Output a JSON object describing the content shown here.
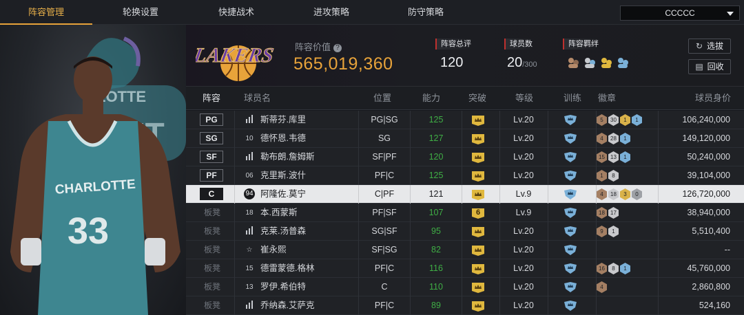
{
  "tabs": [
    "阵容管理",
    "轮换设置",
    "快捷战术",
    "进攻策略",
    "防守策略"
  ],
  "selector": {
    "value": "CCCCC"
  },
  "header": {
    "value_label": "阵容价值",
    "value": "565,019,360",
    "overall_label": "阵容总评",
    "overall": "120",
    "players_label": "球员数",
    "players": "20",
    "players_max": "/300",
    "bond_label": "阵容羁绊",
    "scout_btn": "选拔",
    "recycle_btn": "回收"
  },
  "columns": [
    "阵容",
    "球员名",
    "位置",
    "能力",
    "突破",
    "等级",
    "训练",
    "徽章",
    "球员身价"
  ],
  "colors": {
    "accent": "#e8a33a",
    "green": "#3fae45",
    "selected": "#e7e8ea"
  },
  "rows": [
    {
      "slot": "PG",
      "num": "",
      "name": "斯蒂芬.库里",
      "pos": "PG|SG",
      "ability": "125",
      "breakthrough": "crown",
      "level": "Lv.20",
      "badges": [
        {
          "c": "br",
          "t": "5"
        },
        {
          "c": "sv",
          "t": "30"
        },
        {
          "c": "gd",
          "t": "1"
        },
        {
          "c": "bl",
          "t": "1"
        }
      ],
      "value": "106,240,000"
    },
    {
      "slot": "SG",
      "num": "10",
      "name": "德怀恩.韦德",
      "pos": "SG",
      "ability": "127",
      "breakthrough": "crown",
      "level": "Lv.20",
      "badges": [
        {
          "c": "br",
          "t": "4"
        },
        {
          "c": "sv",
          "t": "28"
        },
        {
          "c": "bl",
          "t": "1"
        }
      ],
      "value": "149,120,000"
    },
    {
      "slot": "SF",
      "num": "",
      "name": "勒布朗.詹姆斯",
      "pos": "SF|PF",
      "ability": "120",
      "breakthrough": "crown",
      "level": "Lv.20",
      "badges": [
        {
          "c": "br",
          "t": "15"
        },
        {
          "c": "sv",
          "t": "13"
        },
        {
          "c": "bl",
          "t": "1"
        }
      ],
      "value": "50,240,000"
    },
    {
      "slot": "PF",
      "num": "06",
      "name": "克里斯.波什",
      "pos": "PF|C",
      "ability": "125",
      "breakthrough": "crown",
      "level": "Lv.20",
      "badges": [
        {
          "c": "br",
          "t": "1"
        },
        {
          "c": "sv",
          "t": "8"
        }
      ],
      "value": "39,104,000"
    },
    {
      "slot": "C",
      "num": "94",
      "name": "阿隆佐.莫宁",
      "pos": "C|PF",
      "ability": "121",
      "breakthrough": "crown",
      "level": "Lv.9",
      "badges": [
        {
          "c": "br",
          "t": "4"
        },
        {
          "c": "sv",
          "t": "18"
        },
        {
          "c": "gd",
          "t": "3"
        },
        {
          "c": "gr",
          "t": "0"
        }
      ],
      "value": "126,720,000"
    },
    {
      "slot": "板凳",
      "num": "18",
      "name": "本.西蒙斯",
      "pos": "PF|SF",
      "ability": "107",
      "breakthrough": "6",
      "level": "Lv.9",
      "badges": [
        {
          "c": "br",
          "t": "18"
        },
        {
          "c": "sv",
          "t": "17"
        }
      ],
      "value": "38,940,000"
    },
    {
      "slot": "板凳",
      "num": "",
      "name": "克莱.汤普森",
      "pos": "SG|SF",
      "ability": "95",
      "breakthrough": "crown",
      "level": "Lv.20",
      "badges": [
        {
          "c": "br",
          "t": "9"
        },
        {
          "c": "sv",
          "t": "1"
        }
      ],
      "value": "5,510,400"
    },
    {
      "slot": "板凳",
      "num": "☆",
      "name": "崔永熙",
      "pos": "SF|SG",
      "ability": "82",
      "breakthrough": "crown",
      "level": "Lv.20",
      "badges": [],
      "value": "--"
    },
    {
      "slot": "板凳",
      "num": "15",
      "name": "德雷蒙德.格林",
      "pos": "PF|C",
      "ability": "116",
      "breakthrough": "crown",
      "level": "Lv.20",
      "badges": [
        {
          "c": "br",
          "t": "16"
        },
        {
          "c": "sv",
          "t": "8"
        },
        {
          "c": "bl",
          "t": "1"
        }
      ],
      "value": "45,760,000"
    },
    {
      "slot": "板凳",
      "num": "13",
      "name": "罗伊.希伯特",
      "pos": "C",
      "ability": "110",
      "breakthrough": "crown",
      "level": "Lv.20",
      "badges": [
        {
          "c": "br",
          "t": "4"
        }
      ],
      "value": "2,860,800"
    },
    {
      "slot": "板凳",
      "num": "",
      "name": "乔纳森.艾萨克",
      "pos": "PF|C",
      "ability": "89",
      "breakthrough": "crown",
      "level": "Lv.20",
      "badges": [],
      "value": "524,160"
    }
  ]
}
